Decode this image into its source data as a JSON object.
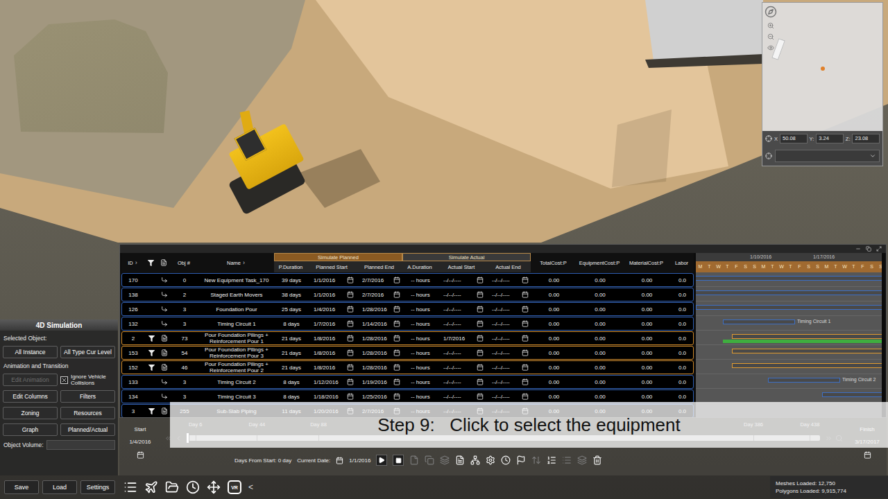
{
  "minimap": {
    "coords": [
      {
        "axis": "X",
        "value": "50.08"
      },
      {
        "axis": "Y:",
        "value": "3.24"
      },
      {
        "axis": "Z:",
        "value": "23.08"
      }
    ]
  },
  "table": {
    "groups": [
      {
        "label": "Simulate Planned",
        "color": "#8a5a22"
      },
      {
        "label": "Simulate Actual",
        "color": "#3a3a3a"
      }
    ],
    "columns": [
      {
        "key": "id",
        "label": "ID",
        "arrow": "›",
        "kind": "text"
      },
      {
        "key": "filter",
        "kind": "icon"
      },
      {
        "key": "icon",
        "kind": "icon"
      },
      {
        "key": "obj",
        "label": "Obj #",
        "kind": "text"
      },
      {
        "key": "name",
        "label": "Name",
        "arrow": "›",
        "kind": "text"
      },
      {
        "key": "p_duration",
        "label": "P.Duration",
        "group": 0,
        "kind": "text"
      },
      {
        "key": "p_start",
        "label": "Planned Start",
        "group": 0,
        "kind": "date"
      },
      {
        "key": "p_end",
        "label": "Planned End",
        "group": 0,
        "kind": "date"
      },
      {
        "key": "a_duration",
        "label": "A.Duration",
        "group": 1,
        "kind": "text"
      },
      {
        "key": "a_start",
        "label": "Actual Start",
        "group": 1,
        "kind": "date"
      },
      {
        "key": "a_end",
        "label": "Actual End",
        "group": 1,
        "kind": "date"
      },
      {
        "key": "total",
        "label": "TotalCost:P",
        "kind": "text"
      },
      {
        "key": "equipment",
        "label": "EquipmentCost:P",
        "kind": "text"
      },
      {
        "key": "material",
        "label": "MaterialCost:P",
        "kind": "text"
      },
      {
        "key": "labor",
        "label": "Labor",
        "kind": "text"
      }
    ],
    "rows": [
      {
        "id": "170",
        "filtered": false,
        "obj": "0",
        "name": "New Equipment Task_170",
        "p_duration": "39 days",
        "p_start": "1/1/2016",
        "p_end": "2/7/2016",
        "a_duration": "-- hours",
        "a_start": "--/--/----",
        "a_end": "--/--/----",
        "total": "0.00",
        "equipment": "0.00",
        "material": "0.00",
        "labor": "0.0",
        "color": "#2f5fb3",
        "bars": [
          {
            "kind": "planned",
            "start": 1,
            "end": 39,
            "color": "#3d6fc4"
          }
        ]
      },
      {
        "id": "138",
        "filtered": false,
        "obj": "2",
        "name": "Staged Earth Movers",
        "p_duration": "38 days",
        "p_start": "1/1/2016",
        "p_end": "2/7/2016",
        "a_duration": "-- hours",
        "a_start": "--/--/----",
        "a_end": "--/--/----",
        "total": "0.00",
        "equipment": "0.00",
        "material": "0.00",
        "labor": "0.0",
        "color": "#2f5fb3",
        "bars": [
          {
            "kind": "planned",
            "start": 1,
            "end": 39,
            "color": "#3d6fc4"
          }
        ]
      },
      {
        "id": "126",
        "filtered": false,
        "obj": "3",
        "name": "Foundation Pour",
        "p_duration": "25 days",
        "p_start": "1/4/2016",
        "p_end": "1/28/2016",
        "a_duration": "-- hours",
        "a_start": "--/--/----",
        "a_end": "--/--/----",
        "total": "0.00",
        "equipment": "0.00",
        "material": "0.00",
        "labor": "0.0",
        "color": "#2f5fb3",
        "bars": [
          {
            "kind": "planned",
            "start": 4,
            "end": 29,
            "color": "#3d6fc4"
          }
        ]
      },
      {
        "id": "132",
        "filtered": false,
        "obj": "3",
        "name": "Timing Circuit 1",
        "p_duration": "8 days",
        "p_start": "1/7/2016",
        "p_end": "1/14/2016",
        "a_duration": "-- hours",
        "a_start": "--/--/----",
        "a_end": "--/--/----",
        "total": "0.00",
        "equipment": "0.00",
        "material": "0.00",
        "labor": "0.0",
        "color": "#2f5fb3",
        "bars": [
          {
            "kind": "planned",
            "start": 7,
            "end": 15,
            "color": "#3d6fc4",
            "label": "Timing Circuit 1"
          }
        ]
      },
      {
        "id": "2",
        "filtered": true,
        "obj": "73",
        "name": "Pour Foundation Pilings + Reinforcement Pour 1",
        "p_duration": "21 days",
        "p_start": "1/8/2016",
        "p_end": "1/28/2016",
        "a_duration": "-- hours",
        "a_start": "1/7/2016",
        "a_end": "--/--/----",
        "total": "0.00",
        "equipment": "0.00",
        "material": "0.00",
        "labor": "0.0",
        "color": "#d08a2a",
        "bars": [
          {
            "kind": "planned",
            "start": 8,
            "end": 29,
            "color": "#e09a30"
          },
          {
            "kind": "actual",
            "start": 7,
            "end": 40,
            "color": "#3fae3f"
          }
        ]
      },
      {
        "id": "153",
        "filtered": true,
        "obj": "54",
        "name": "Pour Foundation Pilings + Reinforcement Pour 3",
        "p_duration": "21 days",
        "p_start": "1/8/2016",
        "p_end": "1/28/2016",
        "a_duration": "-- hours",
        "a_start": "--/--/----",
        "a_end": "--/--/----",
        "total": "0.00",
        "equipment": "0.00",
        "material": "0.00",
        "labor": "0.0",
        "color": "#d08a2a",
        "bars": [
          {
            "kind": "planned",
            "start": 8,
            "end": 29,
            "color": "#e09a30"
          }
        ]
      },
      {
        "id": "152",
        "filtered": true,
        "obj": "46",
        "name": "Pour Foundation Pilings + Reinforcement Pour 2",
        "p_duration": "21 days",
        "p_start": "1/8/2016",
        "p_end": "1/28/2016",
        "a_duration": "-- hours",
        "a_start": "--/--/----",
        "a_end": "--/--/----",
        "total": "0.00",
        "equipment": "0.00",
        "material": "0.00",
        "labor": "0.0",
        "color": "#d08a2a",
        "bars": [
          {
            "kind": "planned",
            "start": 8,
            "end": 29,
            "color": "#e09a30"
          }
        ]
      },
      {
        "id": "133",
        "filtered": false,
        "obj": "3",
        "name": "Timing Circuit 2",
        "p_duration": "8 days",
        "p_start": "1/12/2016",
        "p_end": "1/19/2016",
        "a_duration": "-- hours",
        "a_start": "--/--/----",
        "a_end": "--/--/----",
        "total": "0.00",
        "equipment": "0.00",
        "material": "0.00",
        "labor": "0.0",
        "color": "#2f5fb3",
        "bars": [
          {
            "kind": "planned",
            "start": 12,
            "end": 20,
            "color": "#3d6fc4",
            "label": "Timing Circuit 2"
          }
        ]
      },
      {
        "id": "134",
        "filtered": false,
        "obj": "3",
        "name": "Timing Circuit 3",
        "p_duration": "8 days",
        "p_start": "1/18/2016",
        "p_end": "1/25/2016",
        "a_duration": "-- hours",
        "a_start": "--/--/----",
        "a_end": "--/--/----",
        "total": "0.00",
        "equipment": "0.00",
        "material": "0.00",
        "labor": "0.0",
        "color": "#2f5fb3",
        "bars": [
          {
            "kind": "planned",
            "start": 18,
            "end": 26,
            "color": "#3d6fc4"
          }
        ]
      },
      {
        "id": "3",
        "filtered": true,
        "obj": "255",
        "name": "Sub-Slab Piping",
        "p_duration": "11 days",
        "p_start": "1/20/2016",
        "p_end": "2/7/2016",
        "a_duration": "-- hours",
        "a_start": "--/--/----",
        "a_end": "--/--/----",
        "total": "0.00",
        "equipment": "0.00",
        "material": "0.00",
        "labor": "0.0",
        "color": "#2f5fb3",
        "bars": []
      }
    ]
  },
  "gantt": {
    "first_day": 4,
    "dates": [
      {
        "label": "1/10/2016",
        "day": 10
      },
      {
        "label": "1/17/2016",
        "day": 17
      }
    ],
    "weekdays": [
      "M",
      "T",
      "W",
      "T",
      "F",
      "S",
      "S",
      "M",
      "T",
      "W",
      "T",
      "F",
      "S",
      "S",
      "M",
      "T",
      "W",
      "T",
      "F",
      "S",
      "S"
    ]
  },
  "sim_panel": {
    "title": "4D Simulation",
    "selected_object_label": "Selected Object:",
    "top_buttons": [
      "All Instance",
      "All Type Cur Level"
    ],
    "animation_label": "Animation and Transition",
    "edit_animation": {
      "label": "Edit Animation",
      "disabled": true
    },
    "ignore_collisions": {
      "label": "Ignore Vehicle Collisions",
      "checked": true
    },
    "buttons": [
      "Edit Columns",
      "Filters",
      "Zoning",
      "Resources",
      "Graph",
      "Planned/Actual"
    ],
    "object_volume_label": "Object Volume:"
  },
  "footer": {
    "buttons": [
      "Save",
      "Load",
      "Settings"
    ],
    "vr": "VR",
    "collapse": "<"
  },
  "timeline": {
    "start_label": "Start",
    "start_date": "1/4/2016",
    "finish_label": "Finish",
    "finish_date": "3/17/2017",
    "level": 0,
    "ticks": [
      {
        "label": "Day 6",
        "pos": 0.015
      },
      {
        "label": "Day 44",
        "pos": 0.112
      },
      {
        "label": "Day 88",
        "pos": 0.209
      },
      {
        "label": "Day 386",
        "pos": 0.895
      },
      {
        "label": "Day 438",
        "pos": 0.984
      }
    ],
    "days_from_start_label": "Days From Start:",
    "days_from_start": "0 day",
    "current_date_label": "Current Date:",
    "current_date": "1/1/2016",
    "tools": [
      {
        "disabled": true
      },
      {
        "disabled": true
      },
      {
        "disabled": true
      },
      {
        "disabled": false
      },
      {
        "disabled": false
      },
      {
        "disabled": false
      },
      {
        "disabled": false
      },
      {
        "disabled": false
      },
      {
        "disabled": true
      },
      {
        "disabled": false
      },
      {
        "disabled": true
      },
      {
        "disabled": true
      },
      {
        "disabled": false
      }
    ]
  },
  "caption": {
    "text": "Step 9:   Click to select the equipment"
  },
  "stats": [
    {
      "label": "Meshes Loaded:",
      "value": "12,750"
    },
    {
      "label": "Polygons Loaded:",
      "value": "9,915,774"
    }
  ]
}
